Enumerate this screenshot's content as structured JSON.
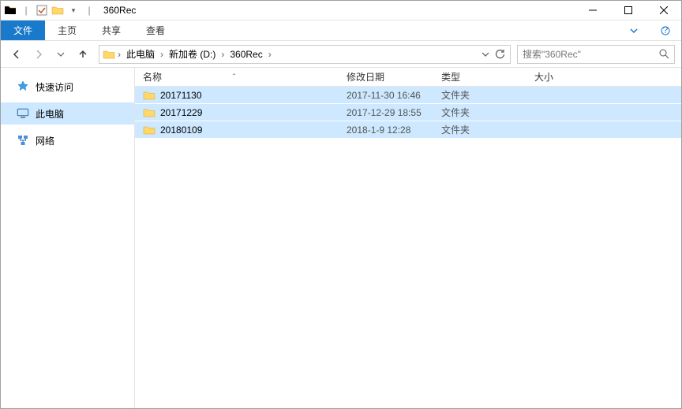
{
  "window": {
    "title": "360Rec"
  },
  "ribbon": {
    "file": "文件",
    "tabs": [
      "主页",
      "共享",
      "查看"
    ]
  },
  "breadcrumbs": {
    "items": [
      "此电脑",
      "新加卷 (D:)",
      "360Rec"
    ]
  },
  "search": {
    "placeholder": "搜索\"360Rec\""
  },
  "sidebar": {
    "items": [
      {
        "label": "快速访问"
      },
      {
        "label": "此电脑"
      },
      {
        "label": "网络"
      }
    ]
  },
  "columns": {
    "name": "名称",
    "date": "修改日期",
    "type": "类型",
    "size": "大小"
  },
  "files": [
    {
      "name": "20171130",
      "date": "2017-11-30 16:46",
      "type": "文件夹",
      "size": ""
    },
    {
      "name": "20171229",
      "date": "2017-12-29 18:55",
      "type": "文件夹",
      "size": ""
    },
    {
      "name": "20180109",
      "date": "2018-1-9 12:28",
      "type": "文件夹",
      "size": ""
    }
  ]
}
